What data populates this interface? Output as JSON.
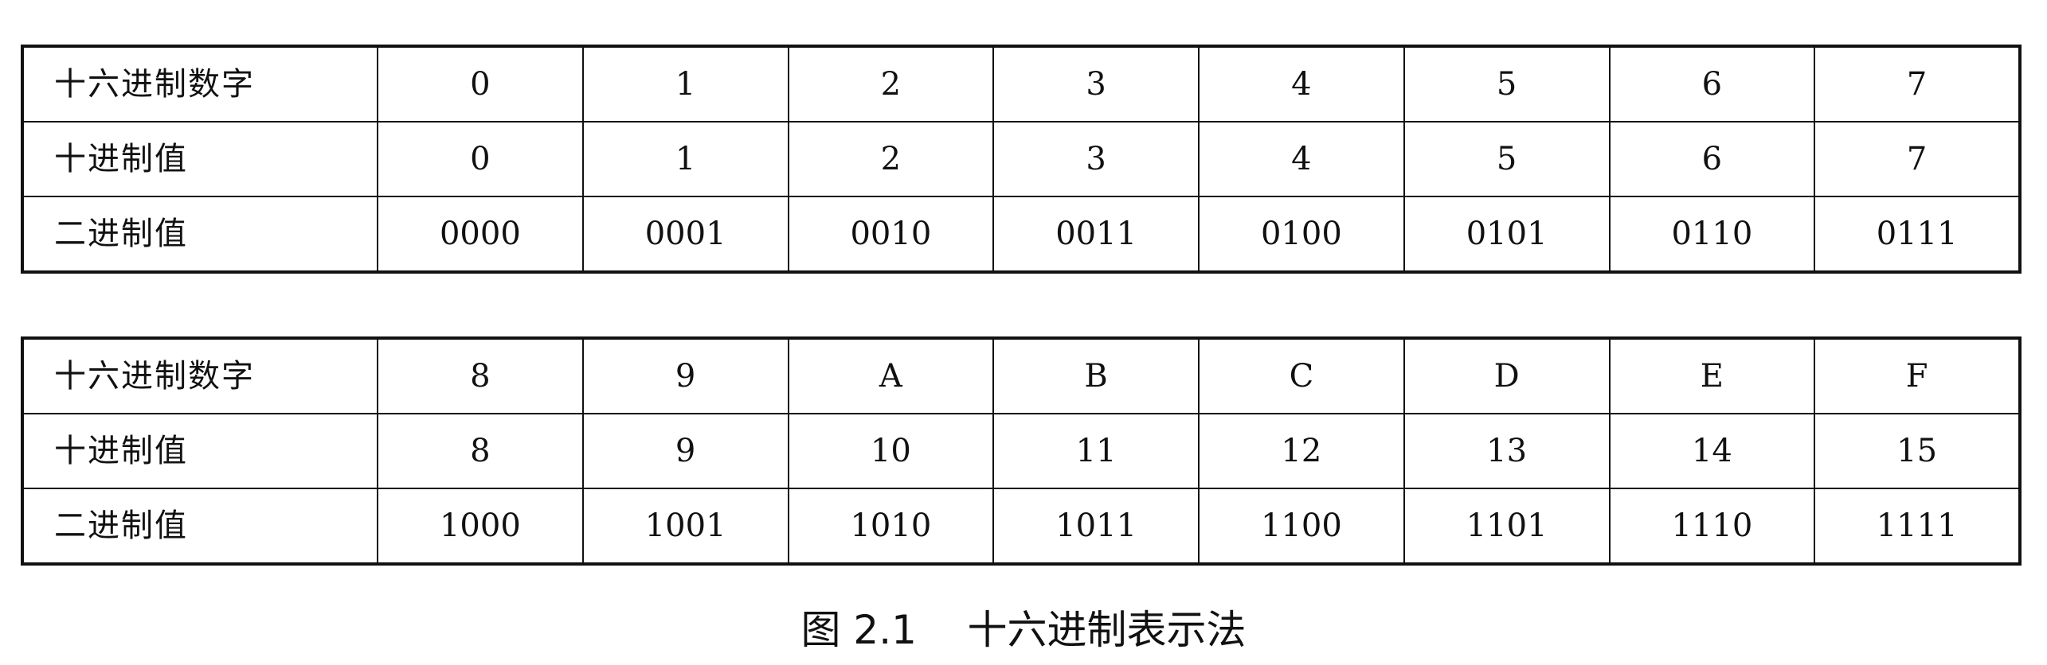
{
  "tables": [
    {
      "rows": [
        {
          "label": "十六进制数字",
          "cells": [
            "0",
            "1",
            "2",
            "3",
            "4",
            "5",
            "6",
            "7"
          ]
        },
        {
          "label": "十进制值",
          "cells": [
            "0",
            "1",
            "2",
            "3",
            "4",
            "5",
            "6",
            "7"
          ]
        },
        {
          "label": "二进制值",
          "cells": [
            "0000",
            "0001",
            "0010",
            "0011",
            "0100",
            "0101",
            "0110",
            "0111"
          ]
        }
      ]
    },
    {
      "rows": [
        {
          "label": "十六进制数字",
          "cells": [
            "8",
            "9",
            "A",
            "B",
            "C",
            "D",
            "E",
            "F"
          ]
        },
        {
          "label": "十进制值",
          "cells": [
            "8",
            "9",
            "10",
            "11",
            "12",
            "13",
            "14",
            "15"
          ]
        },
        {
          "label": "二进制值",
          "cells": [
            "1000",
            "1001",
            "1010",
            "1011",
            "1100",
            "1101",
            "1110",
            "1111"
          ]
        }
      ]
    }
  ],
  "caption": "图 2.1    十六进制表示法"
}
